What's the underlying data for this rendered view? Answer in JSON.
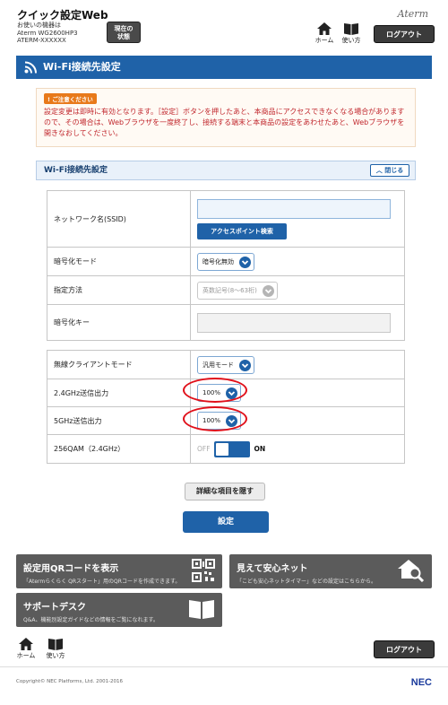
{
  "header": {
    "app_title": "クイック設定Web",
    "device_caption": "お使いの機器は",
    "device_model": "Aterm WG2600HP3",
    "device_id": "ATERM-XXXXXX",
    "state_btn_line1": "現在の",
    "state_btn_line2": "状態",
    "brand": "Aterm",
    "home_label": "ホーム",
    "help_label": "使い方",
    "logout_label": "ログアウト"
  },
  "page_title": "Wi-Fi接続先設定",
  "notice": {
    "badge": "ご注意ください",
    "text": "設定変更は即時に有効となります。［設定］ボタンを押したあと、本商品にアクセスできなくなる場合がありますので、その場合は、Webブラウザを一度終了し、接続する端末と本商品の設定をあわせたあと、Webブラウザを開きなおしてください。"
  },
  "section": {
    "title": "Wi-Fi接続先設定",
    "close_label": "閉じる"
  },
  "form1": {
    "ssid_label": "ネットワーク名(SSID)",
    "ssid_value": "",
    "ap_search_label": "アクセスポイント検索",
    "enc_mode_label": "暗号化モード",
    "enc_mode_value": "暗号化無効",
    "method_label": "指定方法",
    "method_value": "英数記号(8～63桁)",
    "key_label": "暗号化キー",
    "key_value": ""
  },
  "form2": {
    "client_mode_label": "無線クライアントモード",
    "client_mode_value": "汎用モード",
    "tx24_label": "2.4GHz送信出力",
    "tx24_value": "100%",
    "tx5_label": "5GHz送信出力",
    "tx5_value": "100%",
    "qam_label": "256QAM（2.4GHz）",
    "qam_off": "OFF",
    "qam_on": "ON"
  },
  "buttons": {
    "hide_details": "詳細な項目を隠す",
    "submit": "設定"
  },
  "panels": {
    "qr_title": "設定用QRコードを表示",
    "qr_desc": "「Atermらくらく QRスタート」用のQRコードを作成できます。",
    "safe_title": "見えて安心ネット",
    "safe_desc": "「こども安心ネットタイマー」などの設定はこちらから。",
    "support_title": "サポートデスク",
    "support_desc": "Q&A、機能別設定ガイドなどの情報をご覧になれます。"
  },
  "footer": {
    "home_label": "ホーム",
    "help_label": "使い方",
    "logout_label": "ログアウト",
    "copyright": "Copyright© NEC Platforms, Ltd. 2001-2016",
    "nec_logo": "NEC"
  },
  "colors": {
    "accent": "#1f62a8",
    "warning_text": "#c1272d",
    "highlight_ring": "#e0101a",
    "panel_gray": "#5b5b5b"
  }
}
